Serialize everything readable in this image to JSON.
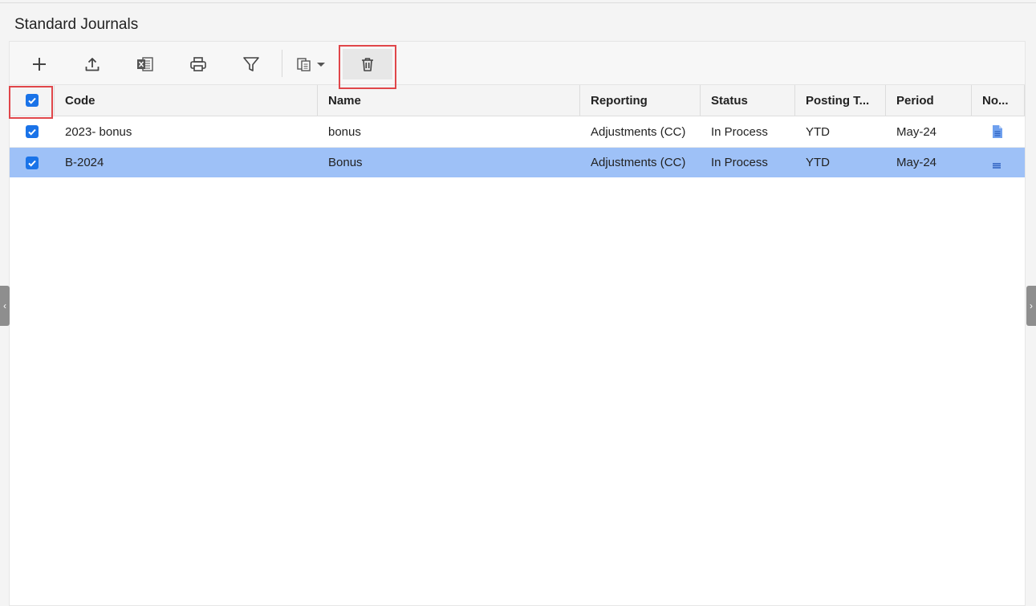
{
  "page": {
    "title": "Standard Journals"
  },
  "toolbar": {
    "buttons": [
      {
        "icon": "plus-icon"
      },
      {
        "icon": "upload-icon"
      },
      {
        "icon": "excel-icon"
      },
      {
        "icon": "print-icon"
      },
      {
        "icon": "filter-icon"
      },
      {
        "icon": "copy-dropdown-icon"
      },
      {
        "icon": "trash-icon"
      }
    ]
  },
  "grid": {
    "columns": [
      "Code",
      "Name",
      "Reporting",
      "Status",
      "Posting T...",
      "Period",
      "No..."
    ],
    "rows": [
      {
        "checked": true,
        "code": "2023- bonus",
        "name": "bonus",
        "reporting": "Adjustments (CC)",
        "status": "In Process",
        "posting": "YTD",
        "period": "May-24",
        "note_icon": "document-icon"
      },
      {
        "checked": true,
        "code": "B-2024",
        "name": "Bonus",
        "reporting": "Adjustments (CC)",
        "status": "In Process",
        "posting": "YTD",
        "period": "May-24",
        "note_icon": "note-lines-icon",
        "selected": true
      }
    ]
  },
  "colors": {
    "selected_row": "#9ec1f7",
    "checkbox": "#1a73e8",
    "highlight": "#e0464a"
  }
}
